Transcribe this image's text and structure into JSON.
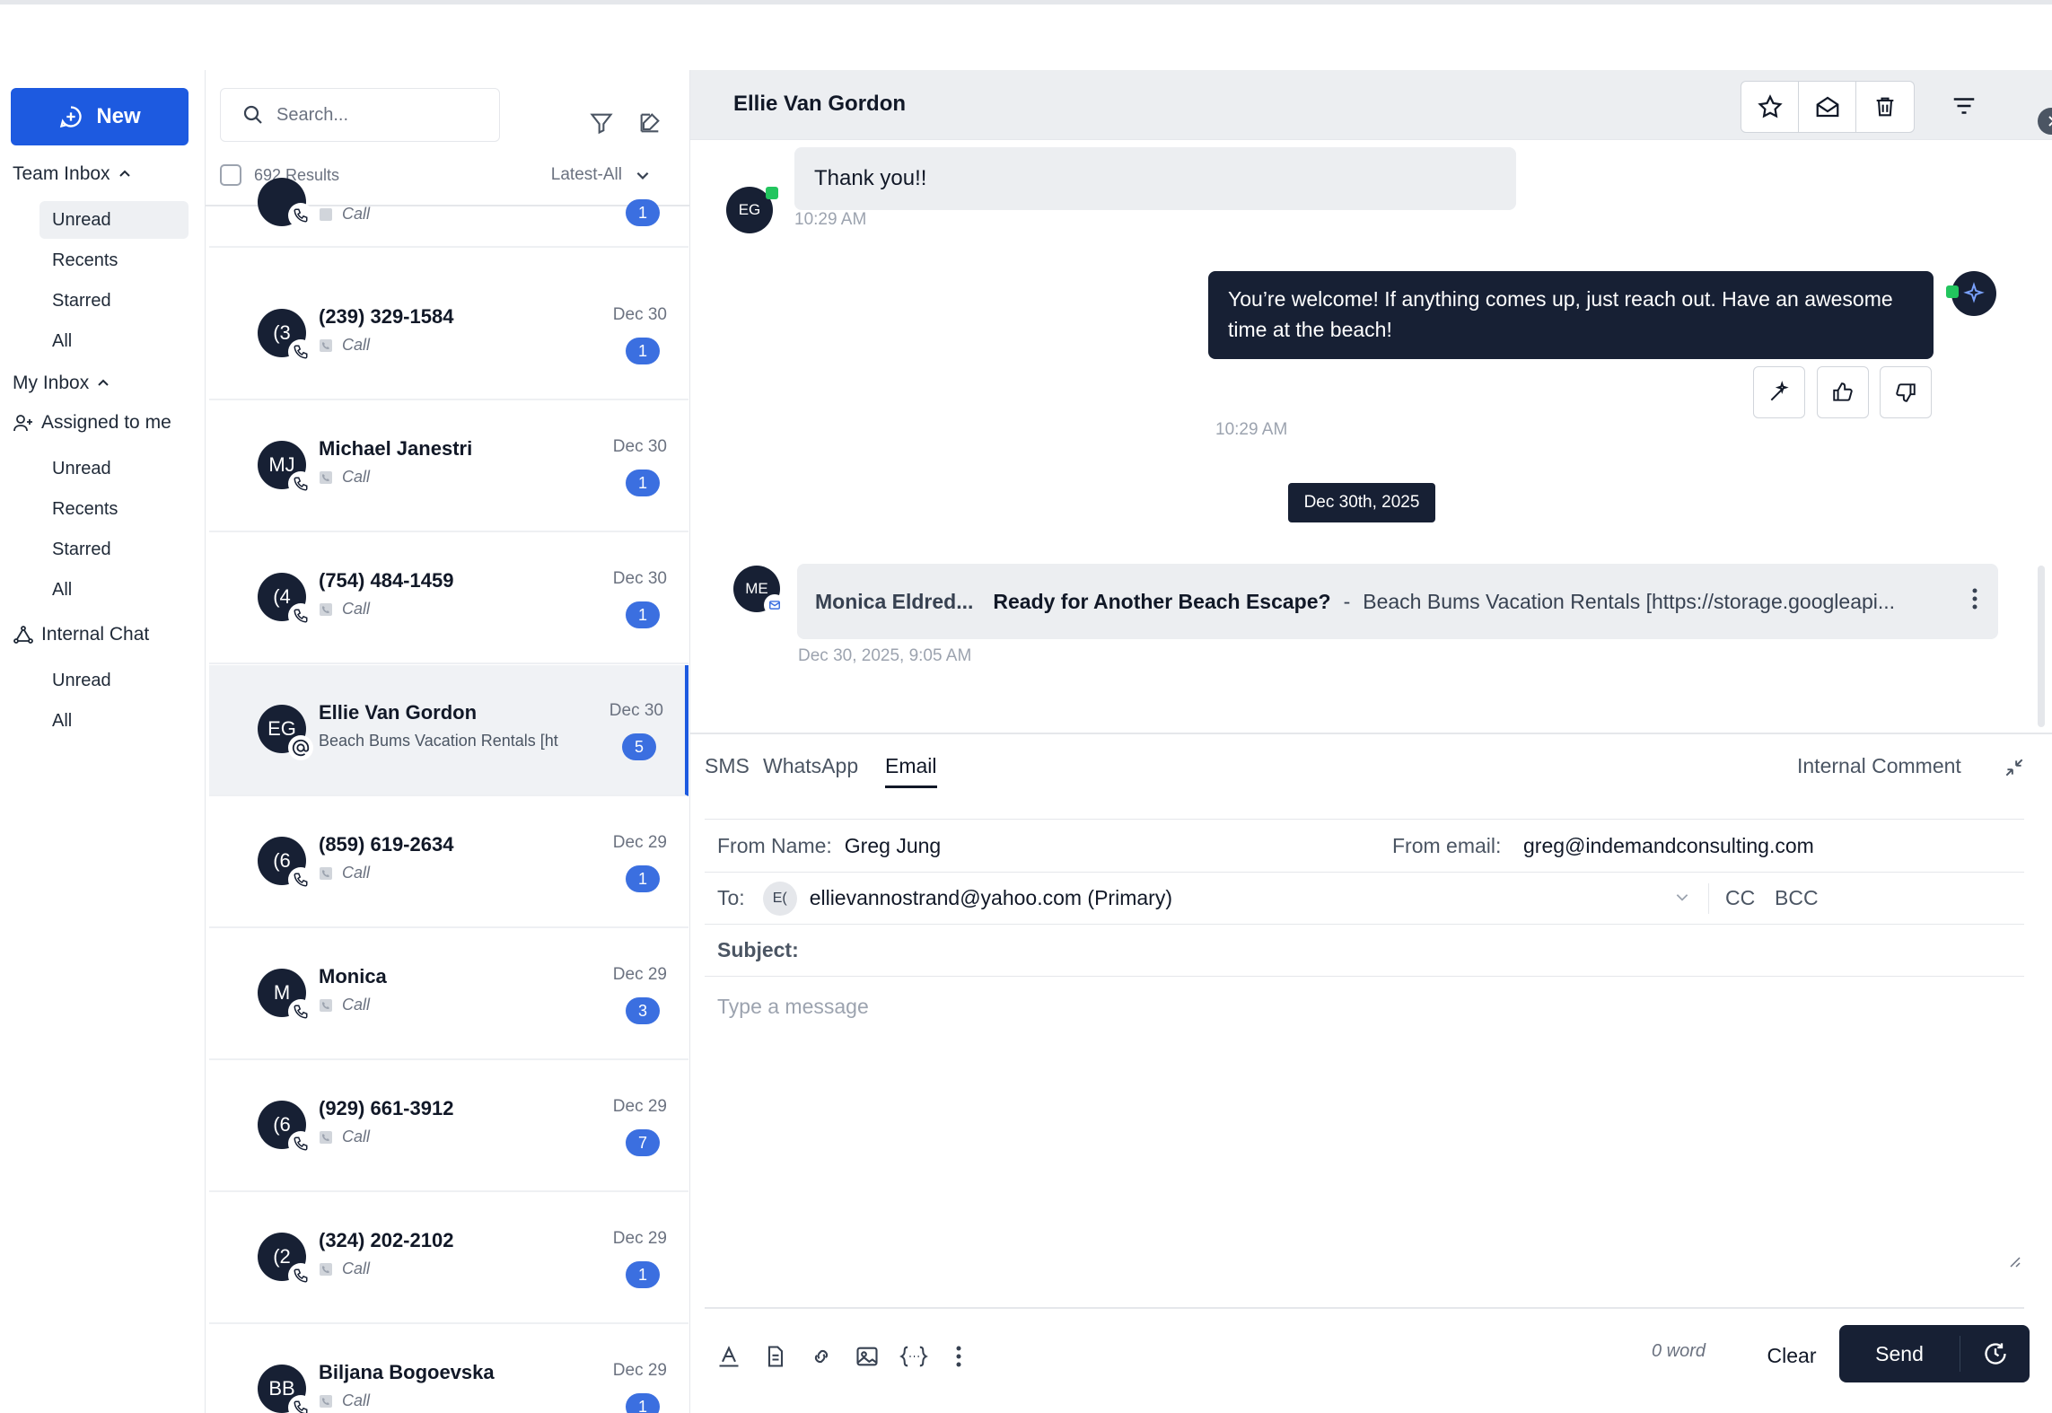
{
  "sidebar": {
    "new_label": "New",
    "team_inbox": {
      "label": "Team Inbox",
      "items": [
        "Unread",
        "Recents",
        "Starred",
        "All"
      ]
    },
    "my_inbox": {
      "label": "My Inbox"
    },
    "assigned": {
      "label": "Assigned to me",
      "items": [
        "Unread",
        "Recents",
        "Starred",
        "All"
      ]
    },
    "internal_chat": {
      "label": "Internal Chat",
      "items": [
        "Unread",
        "All"
      ]
    }
  },
  "list": {
    "search_placeholder": "Search...",
    "results": "692 Results",
    "sort": "Latest-All",
    "partial": {
      "sub": "Call",
      "count": "1"
    },
    "conversations": [
      {
        "avatar": "(3",
        "name": "(239) 329-1584",
        "sub": "Call",
        "date": "Dec 30",
        "count": "1"
      },
      {
        "avatar": "MJ",
        "name": "Michael Janestri",
        "sub": "Call",
        "date": "Dec 30",
        "count": "1"
      },
      {
        "avatar": "(4",
        "name": "(754) 484-1459",
        "sub": "Call",
        "date": "Dec 30",
        "count": "1"
      },
      {
        "avatar": "EG",
        "name": "Ellie Van Gordon",
        "sub": "Beach Bums Vacation Rentals [ht",
        "date": "Dec 30",
        "count": "5"
      },
      {
        "avatar": "(6",
        "name": "(859) 619-2634",
        "sub": "Call",
        "date": "Dec 29",
        "count": "1"
      },
      {
        "avatar": "M",
        "name": "Monica",
        "sub": "Call",
        "date": "Dec 29",
        "count": "3"
      },
      {
        "avatar": "(6",
        "name": "(929) 661-3912",
        "sub": "Call",
        "date": "Dec 29",
        "count": "7"
      },
      {
        "avatar": "(2",
        "name": "(324) 202-2102",
        "sub": "Call",
        "date": "Dec 29",
        "count": "1"
      },
      {
        "avatar": "BB",
        "name": "Biljana Bogoevska",
        "sub": "Call",
        "date": "Dec 29",
        "count": "1"
      }
    ]
  },
  "chat": {
    "title": "Ellie Van Gordon",
    "msg_in": {
      "avatar": "EG",
      "text": "Thank you!!",
      "time": "10:29 AM"
    },
    "msg_out": {
      "text": "You’re welcome! If anything comes up, just reach out. Have an awesome time at the beach!",
      "time": "10:29 AM"
    },
    "date_divider": "Dec 30th, 2025",
    "email": {
      "avatar": "ME",
      "sender": "Monica Eldred...",
      "subject": "Ready for Another Beach Escape?",
      "separator": "-",
      "preview": "Beach Bums Vacation Rentals [https://storage.googleapi...",
      "time": "Dec 30, 2025, 9:05 AM"
    }
  },
  "composer": {
    "tabs": [
      "SMS",
      "WhatsApp",
      "Email"
    ],
    "internal_comment": "Internal Comment",
    "from_name_label": "From Name:",
    "from_name": "Greg Jung",
    "from_email_label": "From email:",
    "from_email": "greg@indemandconsulting.com",
    "to_label": "To:",
    "to_avatar": "E(",
    "to_value": "ellievannostrand@yahoo.com (Primary)",
    "cc": "CC",
    "bcc": "BCC",
    "subject_label": "Subject:",
    "message_placeholder": "Type a message",
    "word_count": "0 word",
    "clear": "Clear",
    "send": "Send"
  },
  "colors": {
    "primary": "#1d5ae0",
    "dark": "#172034",
    "badge": "#3b6fe0"
  }
}
